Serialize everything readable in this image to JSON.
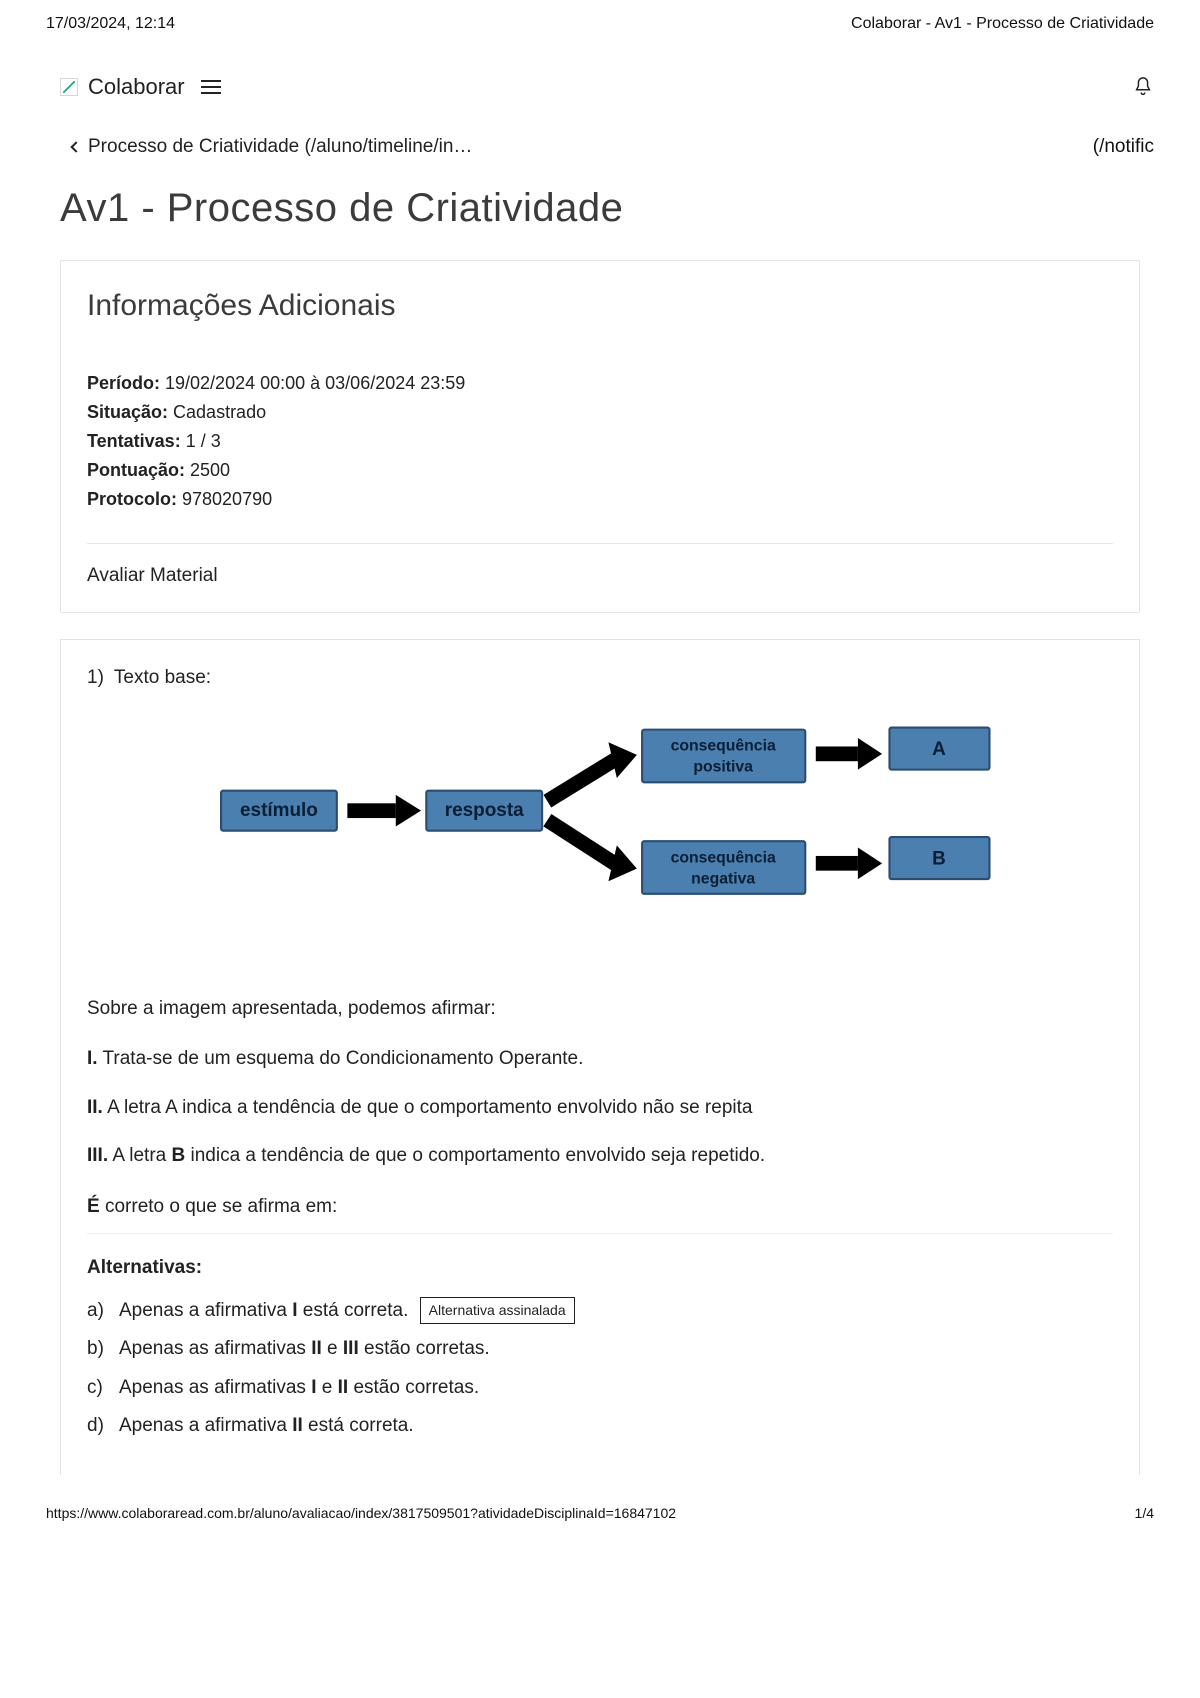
{
  "print_header": {
    "datetime": "17/03/2024, 12:14",
    "doc_title": "Colaborar - Av1 - Processo de Criatividade"
  },
  "topbar": {
    "brand": "Colaborar",
    "notific_truncated": "(/notific"
  },
  "breadcrumb": {
    "text": "Processo de Criatividade (/aluno/timeline/in…"
  },
  "page_title": "Av1 - Processo de Criatividade",
  "info_card": {
    "title": "Informações Adicionais",
    "period_label": "Período:",
    "period_value": " 19/02/2024 00:00 à 03/06/2024 23:59",
    "status_label": "Situação:",
    "status_value": " Cadastrado",
    "attempts_label": "Tentativas:",
    "attempts_value": " 1 / 3",
    "score_label": "Pontuação:",
    "score_value": " 2500",
    "protocol_label": "Protocolo:",
    "protocol_value": " 978020790",
    "rate_material": "Avaliar Material"
  },
  "question": {
    "number": "1)",
    "base_label": "Texto base:",
    "diagram": {
      "color_box_fill": "#4b7faf",
      "color_box_stroke": "#2a4d70",
      "arrow_color": "#000",
      "boxes": {
        "estimulo": "estímulo",
        "resposta": "resposta",
        "cons_pos": "consequência positiva",
        "cons_neg": "consequência negativa",
        "a": "A",
        "b": "B"
      }
    },
    "prompt_intro": "Sobre a imagem apresentada, podemos afirmar:",
    "statements": [
      {
        "label": "I.",
        "text": " Trata-se de um esquema do Condicionamento Operante."
      },
      {
        "label": "II.",
        "text": " A letra A indica a tendência de que o comportamento envolvido não se repita"
      },
      {
        "label": "III.",
        "text": " A letra ",
        "bold_inline": "B",
        "text_after": " indica a tendência de que o comportamento envolvido seja repetido."
      }
    ],
    "correct_prompt_prefix": "É",
    "correct_prompt_rest": " correto o que se afirma em:",
    "alternatives_title": "Alternativas:",
    "alternatives": [
      {
        "letter": "a)",
        "pre": "Apenas a afirmativa ",
        "bold": "I",
        "post": " está correta.",
        "selected": true
      },
      {
        "letter": "b)",
        "pre": "Apenas as afirmativas ",
        "bold": "II",
        "mid": " e ",
        "bold2": "III",
        "post": " estão corretas.",
        "selected": false
      },
      {
        "letter": "c)",
        "pre": "Apenas as afirmativas ",
        "bold": "I",
        "mid": " e ",
        "bold2": "II",
        "post": " estão corretas.",
        "selected": false
      },
      {
        "letter": "d)",
        "pre": "Apenas a afirmativa ",
        "bold": "II",
        "post": " está correta.",
        "selected": false
      }
    ],
    "selected_badge": "Alternativa assinalada"
  },
  "footer": {
    "url": "https://www.colaboraread.com.br/aluno/avaliacao/index/3817509501?atividadeDisciplinaId=16847102",
    "page": "1/4"
  }
}
